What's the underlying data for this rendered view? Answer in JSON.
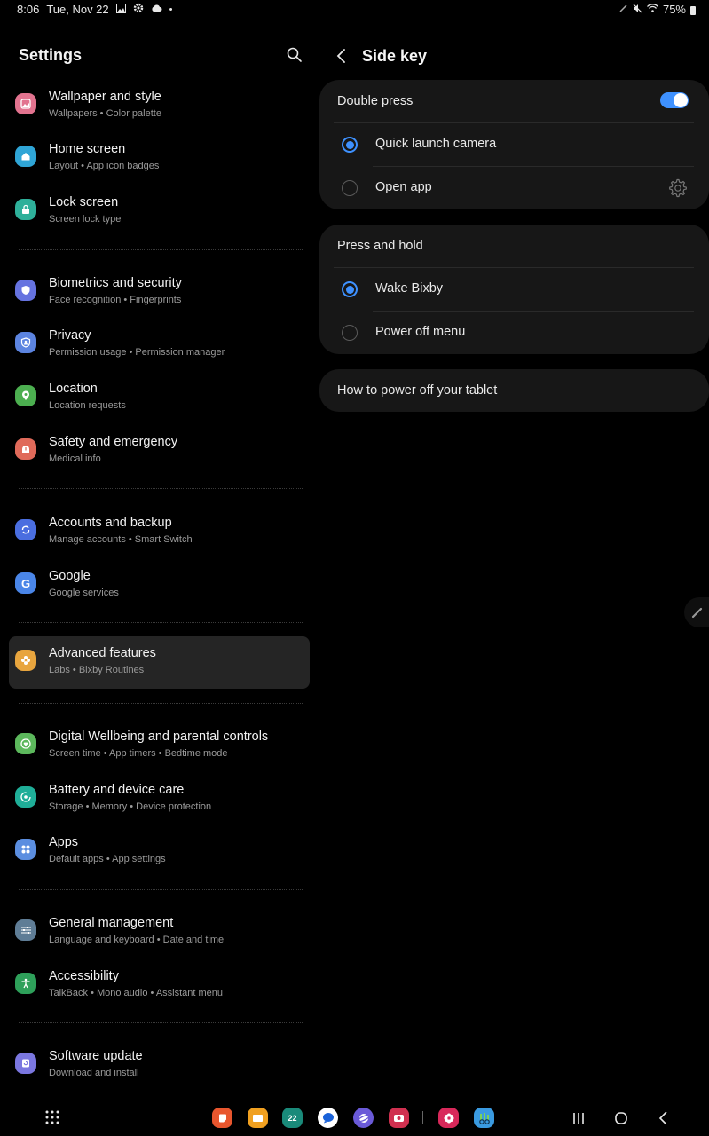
{
  "status_bar": {
    "time": "8:06",
    "date": "Tue, Nov 22",
    "left_icons": [
      "gallery-icon",
      "settings-gear-icon",
      "cloud-icon",
      "dot-icon"
    ],
    "right_icons": [
      "pen-icon",
      "mute-icon",
      "wifi-icon"
    ],
    "battery": "75%"
  },
  "settings": {
    "title": "Settings",
    "search_icon": "search-icon",
    "items": [
      {
        "title": "Wallpaper and style",
        "subtitle": "Wallpapers  •  Color palette",
        "icon": "wallpaper-icon",
        "color": "#e2738f"
      },
      {
        "title": "Home screen",
        "subtitle": "Layout  •  App icon badges",
        "icon": "home-icon",
        "color": "#2fa5d6"
      },
      {
        "title": "Lock screen",
        "subtitle": "Screen lock type",
        "icon": "lock-icon",
        "color": "#2eb09a"
      },
      {
        "title": "Biometrics and security",
        "subtitle": "Face recognition  •  Fingerprints",
        "icon": "shield-icon",
        "color": "#6673e0"
      },
      {
        "title": "Privacy",
        "subtitle": "Permission usage  •  Permission manager",
        "icon": "privacy-icon",
        "color": "#5c84e0"
      },
      {
        "title": "Location",
        "subtitle": "Location requests",
        "icon": "location-pin-icon",
        "color": "#4caf50"
      },
      {
        "title": "Safety and emergency",
        "subtitle": "Medical info",
        "icon": "emergency-icon",
        "color": "#e06a5a"
      },
      {
        "title": "Accounts and backup",
        "subtitle": "Manage accounts  •  Smart Switch",
        "icon": "sync-icon",
        "color": "#4a6ee0"
      },
      {
        "title": "Google",
        "subtitle": "Google services",
        "icon": "google-icon",
        "color": "#4a86e8"
      },
      {
        "title": "Advanced features",
        "subtitle": "Labs  •  Bixby Routines",
        "icon": "advanced-features-icon",
        "color": "#e8a53e",
        "selected": true
      },
      {
        "title": "Digital Wellbeing and parental controls",
        "subtitle": "Screen time  •  App timers  •  Bedtime mode",
        "icon": "wellbeing-icon",
        "color": "#5cb85c"
      },
      {
        "title": "Battery and device care",
        "subtitle": "Storage  •  Memory  •  Device protection",
        "icon": "device-care-icon",
        "color": "#1fae98"
      },
      {
        "title": "Apps",
        "subtitle": "Default apps  •  App settings",
        "icon": "apps-icon",
        "color": "#5b8ee0"
      },
      {
        "title": "General management",
        "subtitle": "Language and keyboard  •  Date and time",
        "icon": "sliders-icon",
        "color": "#5f7d96"
      },
      {
        "title": "Accessibility",
        "subtitle": "TalkBack  •  Mono audio  •  Assistant menu",
        "icon": "accessibility-icon",
        "color": "#2ea05a"
      },
      {
        "title": "Software update",
        "subtitle": "Download and install",
        "icon": "software-update-icon",
        "color": "#7b77e0"
      }
    ]
  },
  "side_key": {
    "title": "Side key",
    "back_icon": "chevron-left-icon",
    "double_press": {
      "label": "Double press",
      "enabled": true,
      "options": [
        {
          "label": "Quick launch camera",
          "selected": true
        },
        {
          "label": "Open app",
          "selected": false,
          "has_settings": true
        }
      ]
    },
    "press_and_hold": {
      "label": "Press and hold",
      "options": [
        {
          "label": "Wake Bixby",
          "selected": true
        },
        {
          "label": "Power off menu",
          "selected": false
        }
      ]
    },
    "help_link": "How to power off your tablet"
  },
  "taskbar": {
    "apps_button_icon": "app-drawer-icon",
    "dock": [
      {
        "name": "samsung-notes-icon",
        "color": "#e8562e"
      },
      {
        "name": "my-files-icon",
        "color": "#f0a020"
      },
      {
        "name": "calendar-icon",
        "color": "#1a8a7a",
        "text": "22"
      },
      {
        "name": "messages-icon",
        "color": "#ffffff"
      },
      {
        "name": "samsung-internet-icon",
        "color": "#6a5ad8"
      },
      {
        "name": "screen-recorder-icon",
        "color": "#d03050"
      },
      {
        "name": "flower-app-icon",
        "color": "#d8285a"
      },
      {
        "name": "galaxy-store-icon",
        "color": "#3a9ae0"
      }
    ],
    "nav": [
      "recents-icon",
      "home-icon",
      "back-icon"
    ]
  },
  "accent_color": "#3e91ff"
}
